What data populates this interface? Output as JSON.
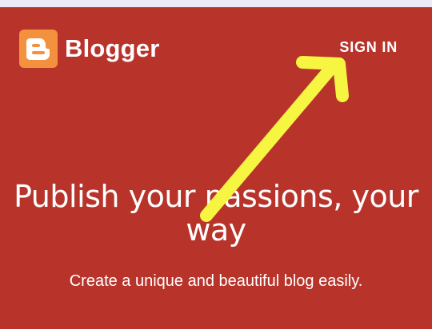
{
  "header": {
    "brand_name": "Blogger",
    "sign_in_label": "SIGN IN"
  },
  "hero": {
    "headline_line1": "Publish your passions, your",
    "headline_line2": "way",
    "subheadline": "Create a unique and beautiful blog easily."
  },
  "colors": {
    "background": "#b8342b",
    "logo_orange": "#f4913f",
    "annotation_arrow": "#f5f542",
    "text": "#ffffff"
  },
  "icons": {
    "logo": "blogger-logo-icon",
    "annotation": "arrow-annotation-icon"
  }
}
